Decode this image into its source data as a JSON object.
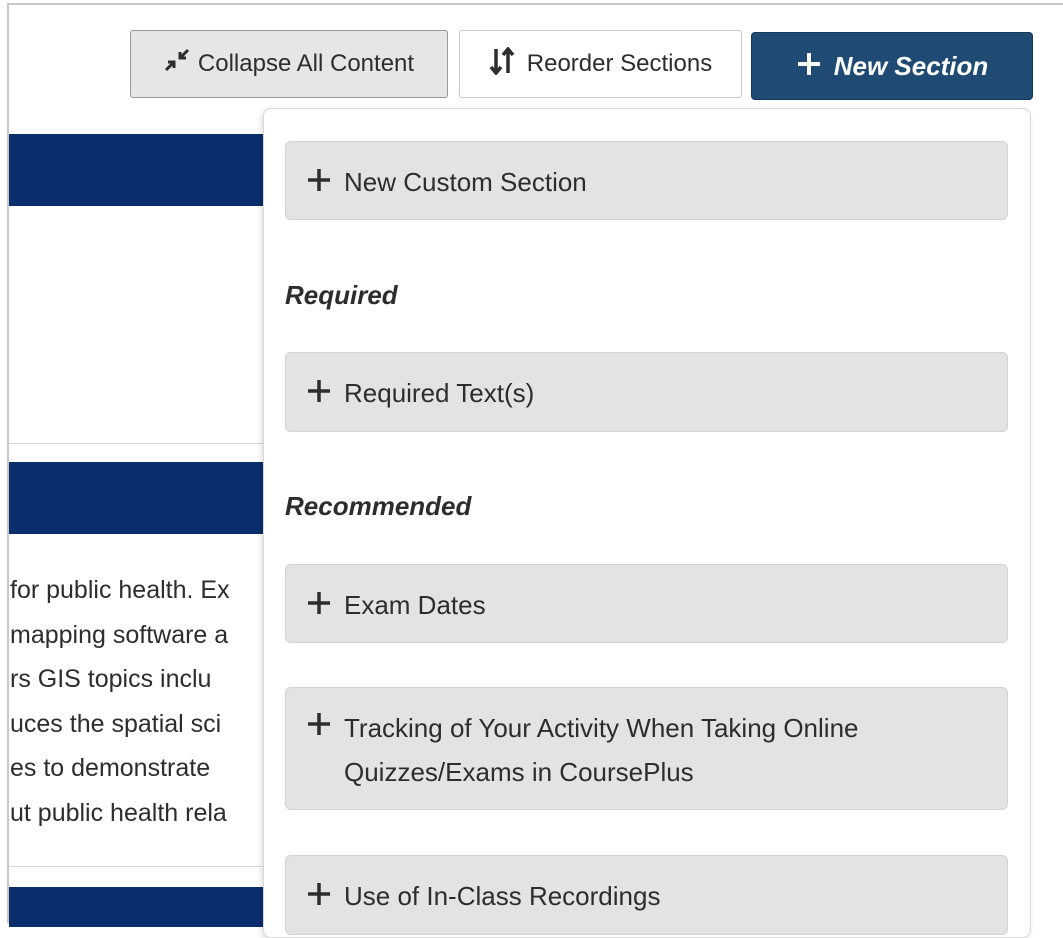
{
  "toolbar": {
    "collapse_label": "Collapse All Content",
    "reorder_label": "Reorder Sections",
    "new_section_label": "New Section"
  },
  "icons": {
    "collapse": "collapse-arrows-icon",
    "reorder": "sort-arrows-icon",
    "plus": "plus-icon"
  },
  "colors": {
    "primary_button": "#1e4a73",
    "section_band": "#0a2d6e",
    "menu_item_bg": "#e3e3e3"
  },
  "background": {
    "lines": [
      "for public health. Ex",
      "mapping software a",
      "rs GIS topics inclu",
      "uces the spatial sci",
      "es to demonstrate",
      "ut public health rela"
    ]
  },
  "menu": {
    "custom_item": "New Custom Section",
    "required_heading": "Required",
    "required_items": [
      "Required Text(s)"
    ],
    "recommended_heading": "Recommended",
    "recommended_items": [
      "Exam Dates",
      "Tracking of Your Activity When Taking Online Quizzes/Exams in CoursePlus",
      "Use of In-Class Recordings"
    ]
  }
}
